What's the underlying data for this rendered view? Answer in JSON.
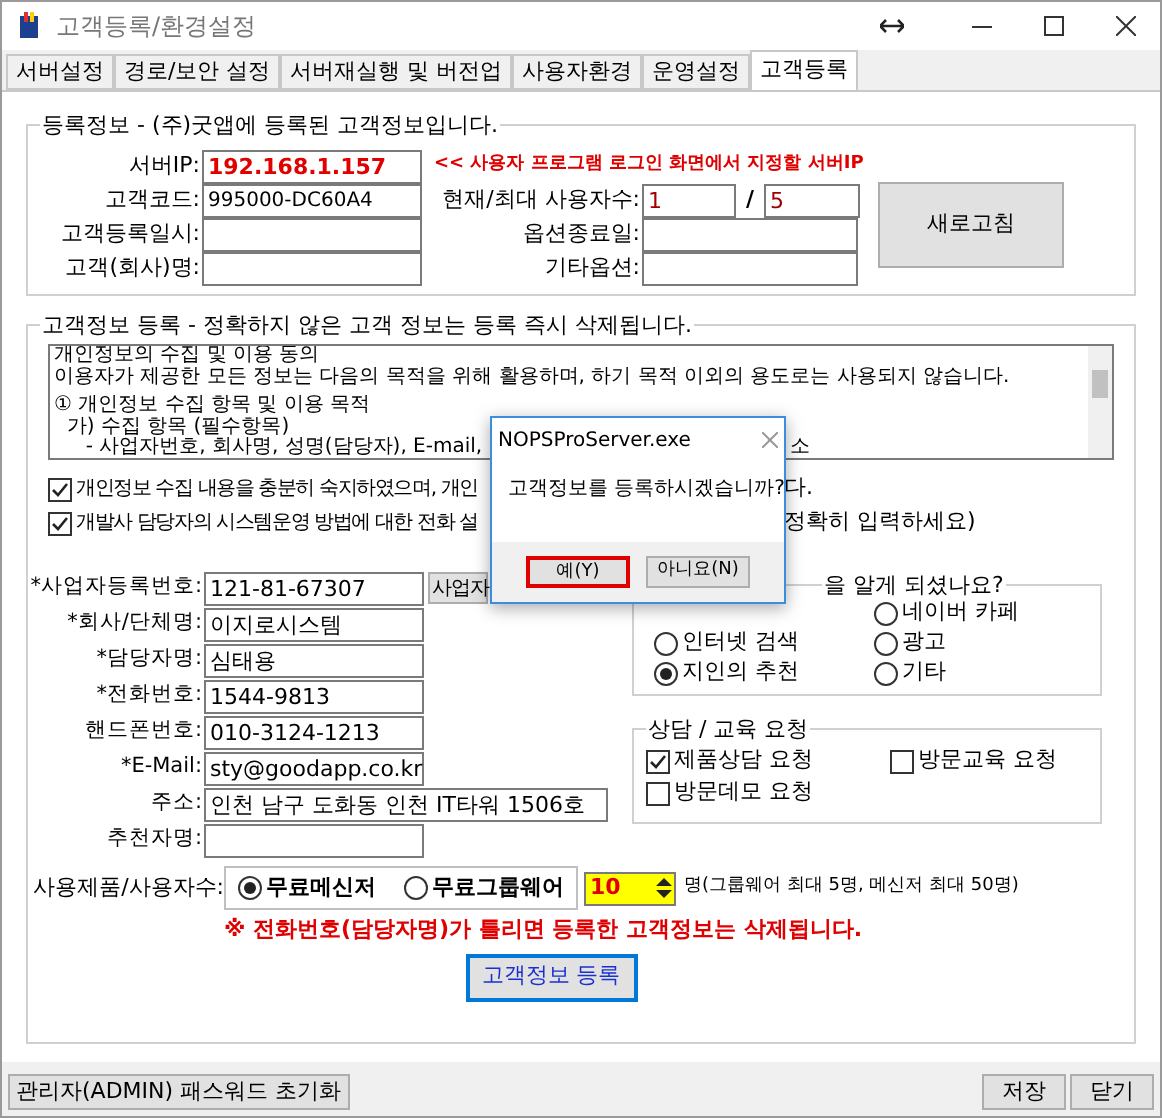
{
  "window": {
    "title": "고객등록/환경설정"
  },
  "tabs": [
    {
      "label": "서버설정",
      "selected": false
    },
    {
      "label": "경로/보안 설정",
      "selected": false
    },
    {
      "label": "서버재실행 및 버전업",
      "selected": false
    },
    {
      "label": "사용자환경",
      "selected": false
    },
    {
      "label": "운영설정",
      "selected": false
    },
    {
      "label": "고객등록",
      "selected": true
    }
  ],
  "registration_info": {
    "legend": "등록정보 - (주)굿앱에 등록된 고객정보입니다.",
    "server_ip": {
      "label": "서버IP:",
      "value": "192.168.1.157"
    },
    "server_ip_note": "<< 사용자 프로그램 로그인 화면에서 지정할 서버IP",
    "customer_code": {
      "label": "고객코드:",
      "value": "995000-DC60A4"
    },
    "registered_at": {
      "label": "고객등록일시:"
    },
    "company_name": {
      "label": "고객(회사)명:"
    },
    "users": {
      "label": "현재/최대 사용자수:",
      "current": "1",
      "separator": "/",
      "max": "5"
    },
    "option_end": {
      "label": "옵션종료일:"
    },
    "other_options": {
      "label": "기타옵션:"
    },
    "refresh_button": "새로고침"
  },
  "customer_registration": {
    "legend": "고객정보 등록 - 정확하지 않은 고객 정보는 등록 즉시 삭제됩니다.",
    "consent_lines": [
      {
        "text": "개인정보의 수집 및 이용 동의"
      },
      {
        "text": "이용자가 제공한 모든 정보는 다음의 목적을 위해 활용하며, 하기 목적 이외의 용도로는 사용되지 않습니다."
      },
      {
        "text": "① 개인정보 수집 항목 및 이용 목적"
      },
      {
        "text": "  가) 수집 항목 (필수항목)"
      },
      {
        "text": "     - 사업자번호, 회사명, 성명(담당자), E-mail,",
        "tail": "소"
      }
    ],
    "checkboxes": [
      {
        "label": "개인정보 수집 내용을 충분히 숙지하였으며, 개인",
        "tail": "다.",
        "checked": true
      },
      {
        "label": "개발사 담당자의 시스템운영 방법에 대한  전화 설",
        "tail": "정확히 입력하세요)",
        "checked": true
      }
    ],
    "fields": [
      {
        "label": "*사업자등록번호:",
        "value": "121-81-67307",
        "kind": "short"
      },
      {
        "label": "*회사/단체명:",
        "value": "이지로시스템",
        "kind": "short"
      },
      {
        "label": "*담당자명:",
        "value": "심태용",
        "kind": "short"
      },
      {
        "label": "*전화번호:",
        "value": "1544-9813",
        "kind": "short"
      },
      {
        "label": "핸드폰번호:",
        "value": "010-3124-1213",
        "kind": "short"
      },
      {
        "label": "*E-Mail:",
        "value": "sty@goodapp.co.kr",
        "kind": "short"
      },
      {
        "label": "주소:",
        "value": "인천 남구 도화동 인천 IT타워 1506호",
        "kind": "long"
      },
      {
        "label": "추천자명:",
        "kind": "short"
      }
    ],
    "business_button": "사업자",
    "referral": {
      "legend": "을 알게 되셨나요?",
      "options": [
        {
          "label": "네이버 카페",
          "selected": false
        },
        {
          "label": "인터넷 검색",
          "selected": false
        },
        {
          "label": "광고",
          "selected": false
        },
        {
          "label": "지인의 추천",
          "selected": true
        },
        {
          "label": "기타",
          "selected": false
        }
      ]
    },
    "consultation": {
      "legend": "상담 / 교육 요청",
      "options": [
        {
          "label": "제품상담 요청",
          "checked": true
        },
        {
          "label": "방문교육 요청",
          "checked": false
        },
        {
          "label": "방문데모 요청",
          "checked": false
        }
      ]
    },
    "product": {
      "label": "사용제품/사용자수:",
      "options": [
        {
          "label": "무료메신저",
          "selected": true
        },
        {
          "label": "무료그룹웨어",
          "selected": false
        }
      ],
      "user_count": "10",
      "note": "명(그룹웨어 최대 5명, 메신저 최대 50명)"
    },
    "warning": "※ 전화번호(담당자명)가 틀리면 등록한 고객정보는 삭제됩니다.",
    "register_button": "고객정보 등록"
  },
  "dialog": {
    "title": "NOPSProServer.exe",
    "message": "고객정보를 등록하시겠습니까?",
    "buttons": [
      {
        "label": "예(Y)",
        "focused": true
      },
      {
        "label": "아니요(N)",
        "focused": false
      }
    ]
  },
  "footer": {
    "reset_button": "관리자(ADMIN) 패스워드 초기화",
    "save_button": "저장",
    "close_button": "닫기"
  }
}
